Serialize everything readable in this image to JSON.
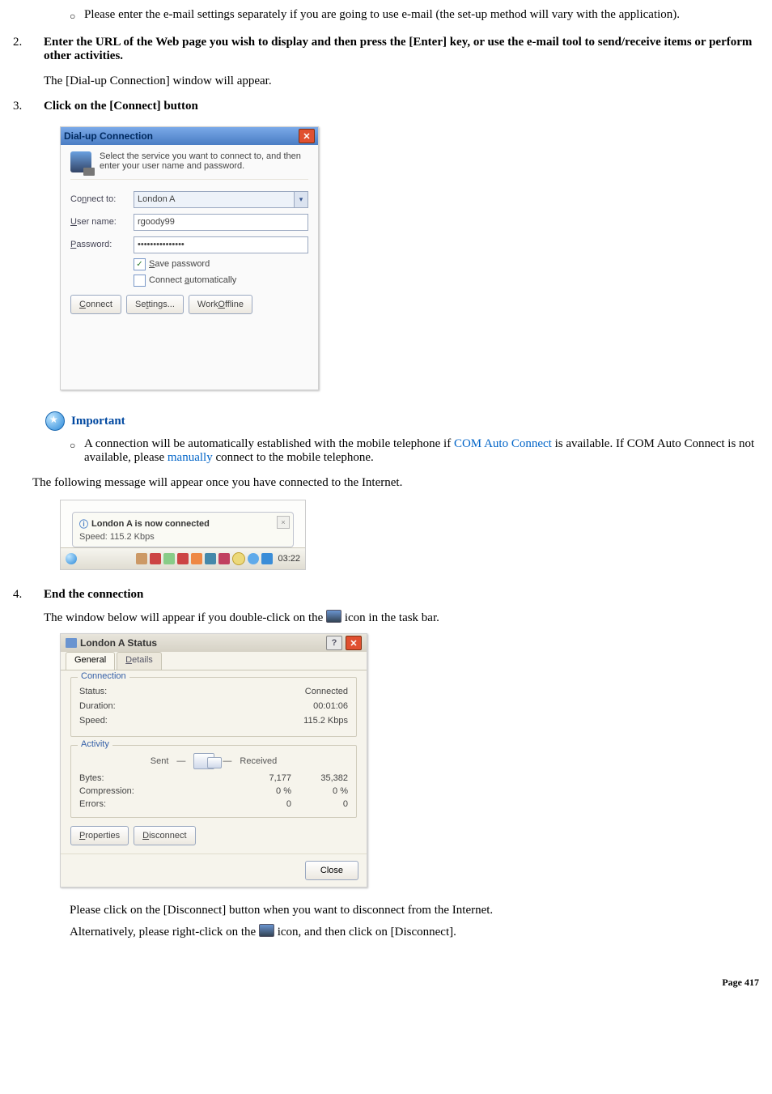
{
  "top_bullet": "Please enter the e-mail settings separately if you are going to use e-mail (the set-up method will vary with the application).",
  "step2": {
    "num": "2.",
    "bold": "Enter the URL of the Web page you wish to display and then press the [Enter] key, or use the e-mail tool to send/receive items or perform other activities.",
    "after": "The [Dial-up Connection] window will appear."
  },
  "step3": {
    "num": "3.",
    "bold": "Click on the [Connect] button"
  },
  "dialup": {
    "title": "Dial-up Connection",
    "intro": "Select the service you want to connect to, and then enter your user name and password.",
    "connect_to_label": "Connect to:",
    "connect_to_value": "London A",
    "user_label": "User name:",
    "user_value": "rgoody99",
    "pass_label": "Password:",
    "pass_value": "•••••••••••••••",
    "save_pw": "Save password",
    "auto": "Connect automatically",
    "btn_connect": "Connect",
    "btn_settings": "Settings...",
    "btn_offline": "Work Offline"
  },
  "important": {
    "label": "Important",
    "text1": "A connection will be automatically established with the mobile telephone if ",
    "link1": "COM Auto Connect",
    "text2": " is available. If COM Auto Connect is not available, please ",
    "link2": "manually",
    "text3": " connect to the mobile telephone."
  },
  "msg_line": "The following message will appear once you have connected to the Internet.",
  "balloon": {
    "title": "London A is now connected",
    "speed": "Speed: 115.2 Kbps",
    "clock": "03:22"
  },
  "step4": {
    "num": "4.",
    "bold": "End the connection",
    "line_a": "The window below will appear if you double-click on the",
    "line_b": "icon in the task bar."
  },
  "status": {
    "title": "London A Status",
    "tab_general": "General",
    "tab_details": "Details",
    "grp_conn": "Connection",
    "status_l": "Status:",
    "status_v": "Connected",
    "dur_l": "Duration:",
    "dur_v": "00:01:06",
    "speed_l": "Speed:",
    "speed_v": "115.2 Kbps",
    "grp_act": "Activity",
    "sent": "Sent",
    "recv": "Received",
    "bytes_l": "Bytes:",
    "bytes_s": "7,177",
    "bytes_r": "35,382",
    "comp_l": "Compression:",
    "comp_s": "0 %",
    "comp_r": "0 %",
    "err_l": "Errors:",
    "err_s": "0",
    "err_r": "0",
    "btn_props": "Properties",
    "btn_disc": "Disconnect",
    "btn_close": "Close"
  },
  "disc_line1": "Please click on the [Disconnect] button when you want to disconnect from the Internet.",
  "disc_line2a": "Alternatively, please right-click on the",
  "disc_line2b": "icon, and then click on [Disconnect].",
  "page_num": "Page 417"
}
